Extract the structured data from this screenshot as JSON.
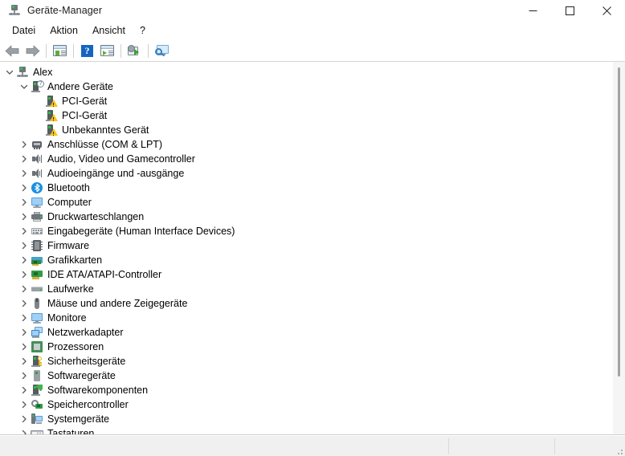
{
  "window": {
    "title": "Geräte-Manager",
    "icon": "device-manager-icon",
    "controls": {
      "minimize": "−",
      "maximize": "□",
      "close": "×"
    }
  },
  "menubar": {
    "items": [
      {
        "label": "Datei",
        "name": "menu-datei"
      },
      {
        "label": "Aktion",
        "name": "menu-aktion"
      },
      {
        "label": "Ansicht",
        "name": "menu-ansicht"
      },
      {
        "label": "?",
        "name": "menu-help"
      }
    ]
  },
  "toolbar": {
    "buttons": [
      {
        "name": "back-button",
        "icon": "back-arrow-icon",
        "tooltip": "Zurück"
      },
      {
        "name": "forward-button",
        "icon": "forward-arrow-icon",
        "tooltip": "Vorwärts"
      },
      {
        "name": "properties-button",
        "icon": "properties-icon",
        "tooltip": "Eigenschaften"
      },
      {
        "name": "help-button",
        "icon": "help-icon",
        "tooltip": "Hilfe",
        "glyph": "?"
      },
      {
        "name": "update-driver-button",
        "icon": "update-driver-icon",
        "tooltip": "Treiber aktualisieren"
      },
      {
        "name": "scan-hardware-button",
        "icon": "scan-hardware-icon",
        "tooltip": "Nach geänderter Hardware suchen"
      },
      {
        "name": "show-devices-button",
        "icon": "show-devices-icon",
        "tooltip": "Geräte anzeigen"
      }
    ]
  },
  "tree": {
    "nodes": [
      {
        "label": "Alex",
        "depth": 0,
        "state": "expanded",
        "icon": "computer-root-icon"
      },
      {
        "label": "Andere Geräte",
        "depth": 1,
        "state": "expanded",
        "icon": "unknown-device-icon"
      },
      {
        "label": "PCI-Gerät",
        "depth": 2,
        "state": "leaf",
        "icon": "warning-device-icon"
      },
      {
        "label": "PCI-Gerät",
        "depth": 2,
        "state": "leaf",
        "icon": "warning-device-icon"
      },
      {
        "label": "Unbekanntes Gerät",
        "depth": 2,
        "state": "leaf",
        "icon": "warning-device-icon"
      },
      {
        "label": "Anschlüsse (COM & LPT)",
        "depth": 1,
        "state": "collapsed",
        "icon": "port-icon"
      },
      {
        "label": "Audio, Video und Gamecontroller",
        "depth": 1,
        "state": "collapsed",
        "icon": "speaker-icon"
      },
      {
        "label": "Audioeingänge und -ausgänge",
        "depth": 1,
        "state": "collapsed",
        "icon": "speaker-icon"
      },
      {
        "label": "Bluetooth",
        "depth": 1,
        "state": "collapsed",
        "icon": "bluetooth-icon"
      },
      {
        "label": "Computer",
        "depth": 1,
        "state": "collapsed",
        "icon": "monitor-icon"
      },
      {
        "label": "Druckwarteschlangen",
        "depth": 1,
        "state": "collapsed",
        "icon": "printer-icon"
      },
      {
        "label": "Eingabegeräte (Human Interface Devices)",
        "depth": 1,
        "state": "collapsed",
        "icon": "hid-icon"
      },
      {
        "label": "Firmware",
        "depth": 1,
        "state": "collapsed",
        "icon": "chip-icon"
      },
      {
        "label": "Grafikkarten",
        "depth": 1,
        "state": "collapsed",
        "icon": "graphics-card-icon"
      },
      {
        "label": "IDE ATA/ATAPI-Controller",
        "depth": 1,
        "state": "collapsed",
        "icon": "ide-controller-icon"
      },
      {
        "label": "Laufwerke",
        "depth": 1,
        "state": "collapsed",
        "icon": "disk-drive-icon"
      },
      {
        "label": "Mäuse und andere Zeigegeräte",
        "depth": 1,
        "state": "collapsed",
        "icon": "mouse-icon"
      },
      {
        "label": "Monitore",
        "depth": 1,
        "state": "collapsed",
        "icon": "monitor-icon"
      },
      {
        "label": "Netzwerkadapter",
        "depth": 1,
        "state": "collapsed",
        "icon": "network-adapter-icon"
      },
      {
        "label": "Prozessoren",
        "depth": 1,
        "state": "collapsed",
        "icon": "processor-icon"
      },
      {
        "label": "Sicherheitsgeräte",
        "depth": 1,
        "state": "collapsed",
        "icon": "security-device-icon"
      },
      {
        "label": "Softwaregeräte",
        "depth": 1,
        "state": "collapsed",
        "icon": "software-device-icon"
      },
      {
        "label": "Softwarekomponenten",
        "depth": 1,
        "state": "collapsed",
        "icon": "software-component-icon"
      },
      {
        "label": "Speichercontroller",
        "depth": 1,
        "state": "collapsed",
        "icon": "storage-controller-icon"
      },
      {
        "label": "Systemgeräte",
        "depth": 1,
        "state": "collapsed",
        "icon": "system-device-icon"
      },
      {
        "label": "Tastaturen",
        "depth": 1,
        "state": "collapsed",
        "icon": "keyboard-icon"
      }
    ]
  },
  "statusbar": {
    "cells": [
      "",
      "",
      ""
    ]
  },
  "colors": {
    "window_bg": "#ffffff",
    "statusbar_bg": "#f0f0f0",
    "accent_blue": "#1565c0",
    "warning_yellow": "#f5c518",
    "led_green": "#2fc24a",
    "scrollbar_thumb": "#a3a3a3"
  }
}
